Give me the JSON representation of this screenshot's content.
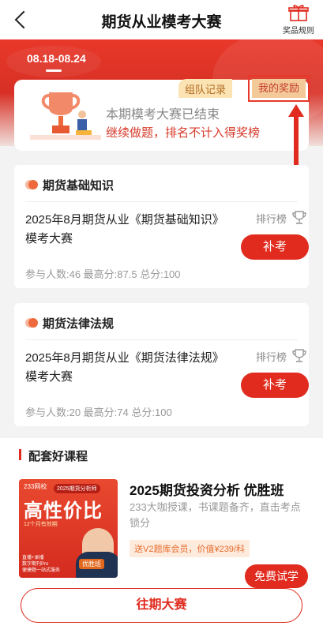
{
  "header": {
    "title": "期货从业模考大赛",
    "prize_rules_label": "奖品规则"
  },
  "banner": {
    "date_tab": "08.18-08.24"
  },
  "result": {
    "title": "本期模考大赛已结束",
    "subtitle": "继续做题，排名不计入得奖榜",
    "group_record_label": "组队记录",
    "my_rewards_label": "我的奖励"
  },
  "exams": [
    {
      "category": "期货基础知识",
      "name": "2025年8月期货从业《期货基础知识》模考大赛",
      "rank_label": "排行榜",
      "action_label": "补考",
      "stats": "参与人数:46  最高分:87.5  总分:100"
    },
    {
      "category": "期货法律法规",
      "name": "2025年8月期货从业《期货法律法规》模考大赛",
      "rank_label": "排行榜",
      "action_label": "补考",
      "stats": "参与人数:20  最高分:74  总分:100"
    }
  ],
  "courses": {
    "section_title": "配套好课程",
    "items": [
      {
        "title": "2025期货投资分析 优胜班",
        "desc": "233大咖授课，书课题备齐，直击考点锁分",
        "gift": "送V2题库会员，价值¥239/科",
        "trial_label": "免费试学",
        "cover": {
          "brand": "233网校",
          "banner": "2025期货分析师",
          "main": "高性价比",
          "sub": "12个月有效期",
          "tag": "优胜班",
          "info_1": "直播+录播",
          "info_2": "数字期刊Pro",
          "info_3": "便捷题一站式服务"
        }
      }
    ]
  },
  "footer": {
    "past_contests_label": "往期大赛"
  },
  "colors": {
    "brand_red": "#e02b1e",
    "banner_red": "#e8382a",
    "tag_gold": "#fbe3b4"
  }
}
